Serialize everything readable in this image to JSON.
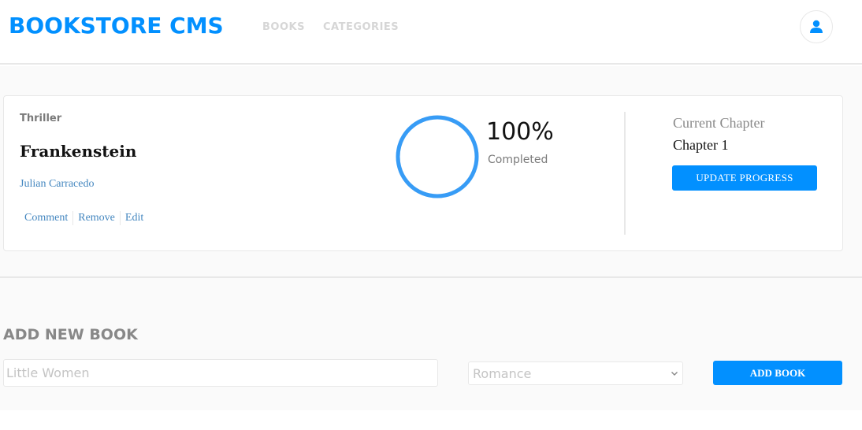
{
  "header": {
    "logo": "BOOKSTORE CMS",
    "nav": [
      {
        "label": "BOOKS"
      },
      {
        "label": "CATEGORIES"
      }
    ],
    "avatar_icon": "user-icon"
  },
  "book": {
    "genre": "Thriller",
    "title": "Frankenstein",
    "author": "Julian Carracedo",
    "actions": [
      {
        "label": "Comment"
      },
      {
        "label": "Remove"
      },
      {
        "label": "Edit"
      }
    ],
    "progress_value": 1.0,
    "progress_percent": "100%",
    "progress_label": "Completed",
    "current_chapter_label": "Current Chapter",
    "current_chapter": "Chapter 1",
    "update_button": "UPDATE PROGRESS"
  },
  "form": {
    "title": "ADD NEW BOOK",
    "title_placeholder": "Little Women",
    "category_selected": "Romance",
    "submit_label": "ADD BOOK"
  },
  "colors": {
    "accent": "#0290ff",
    "progress_ring": "#379cf6",
    "link": "#4386bf"
  }
}
